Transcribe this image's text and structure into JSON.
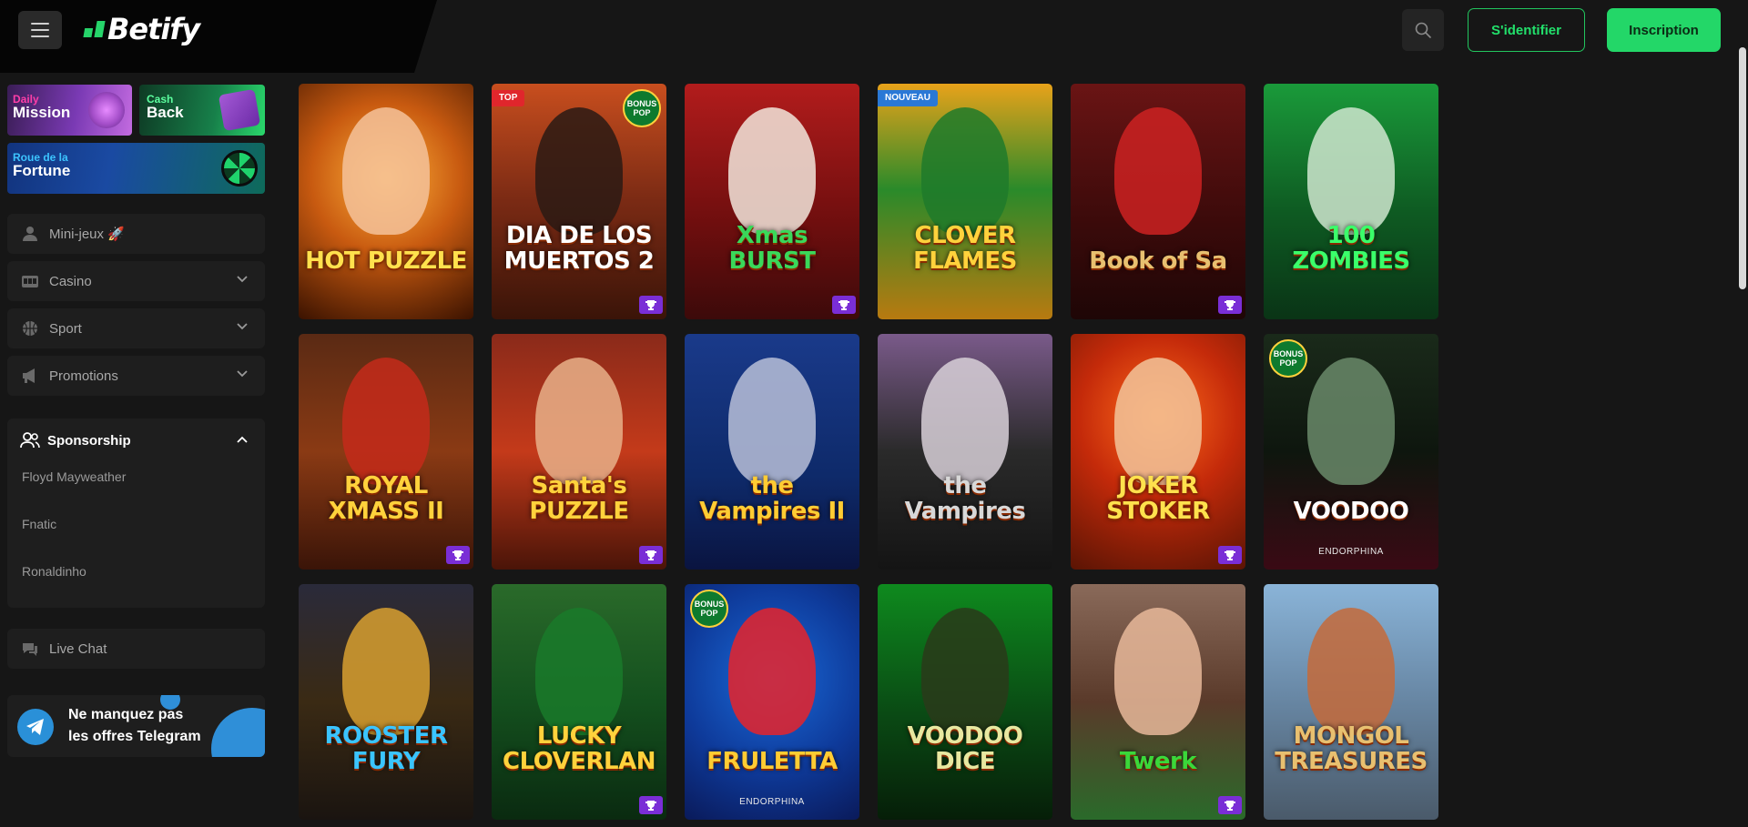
{
  "header": {
    "brand": "Betify",
    "login_label": "S'identifier",
    "signup_label": "Inscription",
    "colors": {
      "accent": "#23d768",
      "background": "#161616"
    }
  },
  "sidebar": {
    "promos": {
      "mission": {
        "small": "Daily",
        "big": "Mission"
      },
      "cashback": {
        "small": "Cash",
        "big": "Back"
      },
      "fortune": {
        "small": "Roue de la",
        "big": "Fortune"
      }
    },
    "nav": [
      {
        "label": "Mini-jeux 🚀",
        "icon": "user-icon"
      },
      {
        "label": "Casino",
        "icon": "slot-machine-icon"
      },
      {
        "label": "Sport",
        "icon": "basketball-icon"
      },
      {
        "label": "Promotions",
        "icon": "megaphone-icon"
      }
    ],
    "sponsorship": {
      "label": "Sponsorship",
      "links": [
        "Floyd Mayweather",
        "Fnatic",
        "Ronaldinho"
      ]
    },
    "live_chat": "Live Chat",
    "telegram": {
      "line1": "Ne manquez pas",
      "line2": "les offres Telegram"
    }
  },
  "games": [
    {
      "title": "HOT PUZZLE",
      "tag": "",
      "bonus": "",
      "trophy": false,
      "provider": ""
    },
    {
      "title": "DIA DE LOS MUERTOS 2",
      "tag": "TOP",
      "bonus": "right",
      "trophy": true,
      "provider": ""
    },
    {
      "title": "Xmas BURST",
      "tag": "",
      "bonus": "",
      "trophy": true,
      "provider": ""
    },
    {
      "title": "CLOVER FLAMES",
      "tag": "NOUVEAU",
      "bonus": "",
      "trophy": false,
      "provider": ""
    },
    {
      "title": "Book of Sa",
      "tag": "",
      "bonus": "",
      "trophy": true,
      "provider": ""
    },
    {
      "title": "100 ZOMBIES",
      "tag": "",
      "bonus": "",
      "trophy": false,
      "provider": ""
    },
    {
      "title": "ROYAL XMASS II",
      "tag": "",
      "bonus": "",
      "trophy": true,
      "provider": ""
    },
    {
      "title": "Santa's PUZZLE",
      "tag": "",
      "bonus": "",
      "trophy": true,
      "provider": ""
    },
    {
      "title": "the Vampires II",
      "tag": "",
      "bonus": "",
      "trophy": false,
      "provider": ""
    },
    {
      "title": "the Vampires",
      "tag": "",
      "bonus": "",
      "trophy": false,
      "provider": ""
    },
    {
      "title": "JOKER STOKER",
      "tag": "",
      "bonus": "",
      "trophy": true,
      "provider": ""
    },
    {
      "title": "VOODOO",
      "tag": "",
      "bonus": "left",
      "trophy": false,
      "provider": "ENDORPHINA"
    },
    {
      "title": "ROOSTER FURY",
      "tag": "",
      "bonus": "",
      "trophy": false,
      "provider": ""
    },
    {
      "title": "LUCKY CLOVERLAN",
      "tag": "",
      "bonus": "",
      "trophy": true,
      "provider": ""
    },
    {
      "title": "FRULETTA",
      "tag": "",
      "bonus": "left",
      "trophy": false,
      "provider": "ENDORPHINA"
    },
    {
      "title": "VOODOO DICE",
      "tag": "",
      "bonus": "",
      "trophy": false,
      "provider": ""
    },
    {
      "title": "Twerk",
      "tag": "",
      "bonus": "",
      "trophy": true,
      "provider": ""
    },
    {
      "title": "MONGOL TREASURES",
      "tag": "",
      "bonus": "",
      "trophy": false,
      "provider": ""
    }
  ],
  "bonus_badge": {
    "line1": "BONUS",
    "line2": "POP"
  }
}
